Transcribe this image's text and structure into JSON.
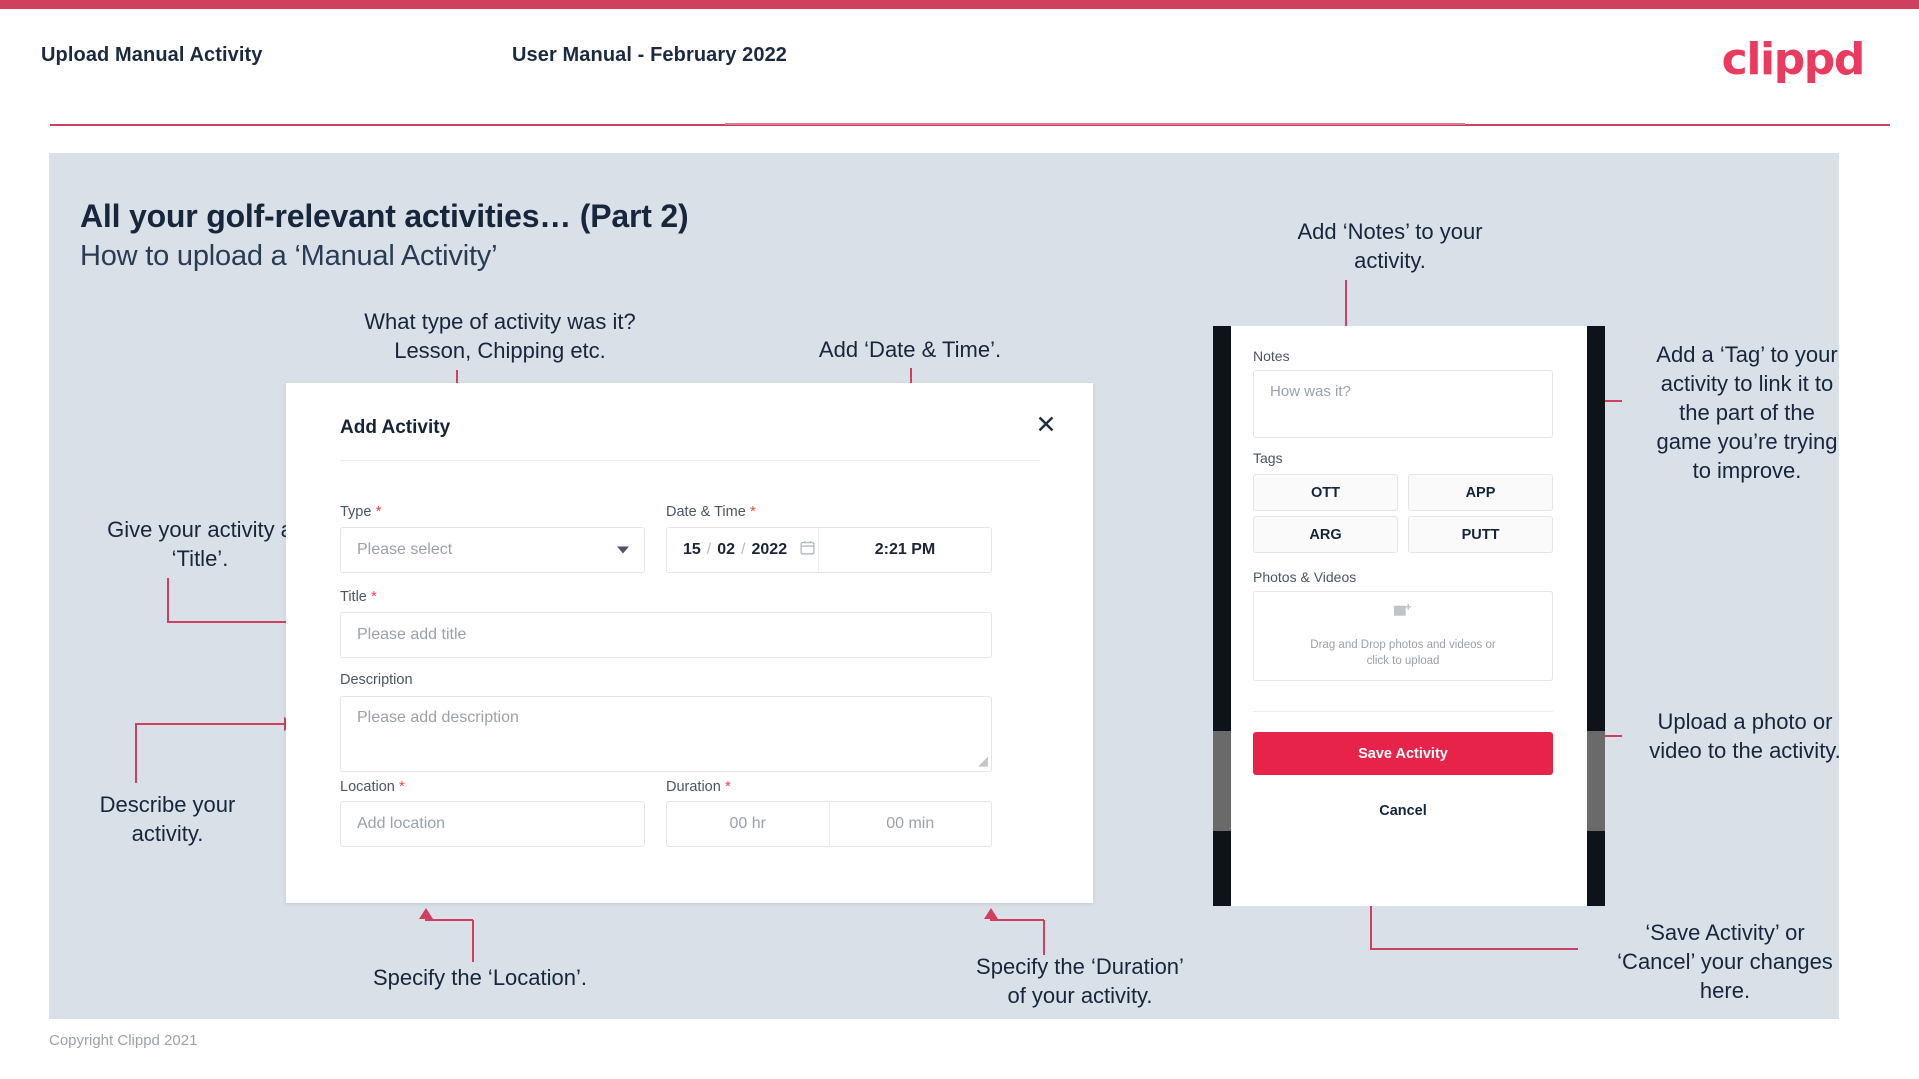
{
  "header": {
    "left_title": "Upload Manual Activity",
    "center_title": "User Manual - February 2022",
    "logo": "clippd"
  },
  "slide": {
    "title": "All your golf-relevant activities… (Part 2)",
    "subtitle": "How to upload a ‘Manual Activity’"
  },
  "annotations": {
    "type": "What type of activity was it?\nLesson, Chipping etc.",
    "datetime": "Add ‘Date & Time’.",
    "title": "Give your activity a\n‘Title’.",
    "description": "Describe your\nactivity.",
    "location": "Specify the ‘Location’.",
    "duration": "Specify the ‘Duration’\nof your activity.",
    "notes": "Add ‘Notes’ to your\nactivity.",
    "tags": "Add a ‘Tag’ to your\nactivity to link it to\nthe part of the\ngame you’re trying\nto improve.",
    "photos": "Upload a photo or\nvideo to the activity.",
    "save_cancel": "‘Save Activity’ or\n‘Cancel’ your changes\nhere."
  },
  "dialog": {
    "title": "Add Activity",
    "close_icon": "✕",
    "fields": {
      "type": {
        "label": "Type",
        "required": true,
        "placeholder": "Please select"
      },
      "datetime": {
        "label": "Date & Time",
        "required": true,
        "day": "15",
        "month": "02",
        "year": "2022",
        "time": "2:21 PM"
      },
      "title": {
        "label": "Title",
        "required": true,
        "placeholder": "Please add title"
      },
      "description": {
        "label": "Description",
        "required": false,
        "placeholder": "Please add description"
      },
      "location": {
        "label": "Location",
        "required": true,
        "placeholder": "Add location"
      },
      "duration": {
        "label": "Duration",
        "required": true,
        "hours": "00 hr",
        "minutes": "00 min"
      }
    }
  },
  "phone": {
    "notes": {
      "label": "Notes",
      "placeholder": "How was it?"
    },
    "tags": {
      "label": "Tags",
      "options": [
        "OTT",
        "APP",
        "ARG",
        "PUTT"
      ]
    },
    "photos": {
      "label": "Photos & Videos",
      "drop_line1": "Drag and Drop photos and videos or",
      "drop_line2": "click to upload"
    },
    "save_label": "Save Activity",
    "cancel_label": "Cancel"
  },
  "footer": {
    "copyright": "Copyright Clippd 2021"
  },
  "colors": {
    "brand": "#e8234a",
    "accent_bar": "#cf4060",
    "slide_bg": "#d9e0e7",
    "text_dark": "#16243a"
  }
}
